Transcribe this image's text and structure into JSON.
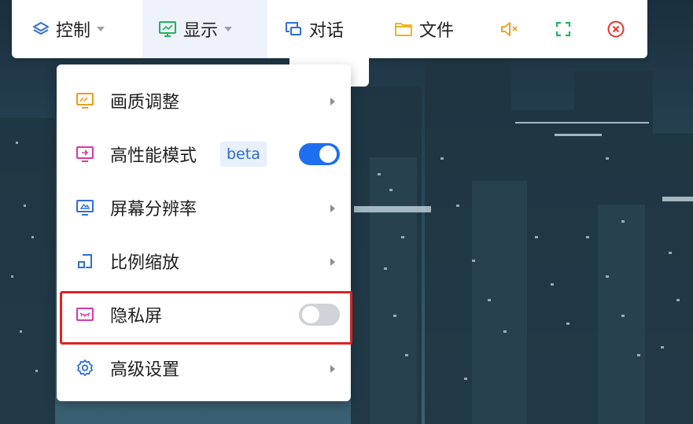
{
  "toolbar": {
    "items": [
      {
        "label": "控制",
        "icon": "layers-icon",
        "has_caret": true
      },
      {
        "label": "显示",
        "icon": "monitor-icon",
        "has_caret": true,
        "active": true
      },
      {
        "label": "对话",
        "icon": "chat-icon"
      },
      {
        "label": "文件",
        "icon": "folder-icon"
      },
      {
        "icon": "mute-icon"
      },
      {
        "icon": "fullscreen-icon"
      },
      {
        "icon": "close-circle-icon"
      }
    ]
  },
  "display_menu": {
    "items": [
      {
        "label": "画质调整",
        "icon": "image-quality-icon",
        "type": "submenu"
      },
      {
        "label": "高性能模式",
        "badge": "beta",
        "icon": "performance-icon",
        "type": "toggle",
        "state": "on"
      },
      {
        "label": "屏幕分辨率",
        "icon": "resolution-icon",
        "type": "submenu"
      },
      {
        "label": "比例缩放",
        "icon": "scale-icon",
        "type": "submenu"
      },
      {
        "label": "隐私屏",
        "icon": "privacy-screen-icon",
        "type": "toggle",
        "state": "off",
        "highlighted": true
      },
      {
        "label": "高级设置",
        "icon": "settings-gear-icon",
        "type": "submenu"
      }
    ]
  },
  "colors": {
    "accent": "#1e6ef0",
    "highlight": "#e0221f",
    "orange_icon": "#f39a1e",
    "pink_icon": "#d63aa8",
    "blue_icon": "#2f6fd8",
    "green_icon": "#22b35e",
    "red_icon": "#e8332e"
  }
}
